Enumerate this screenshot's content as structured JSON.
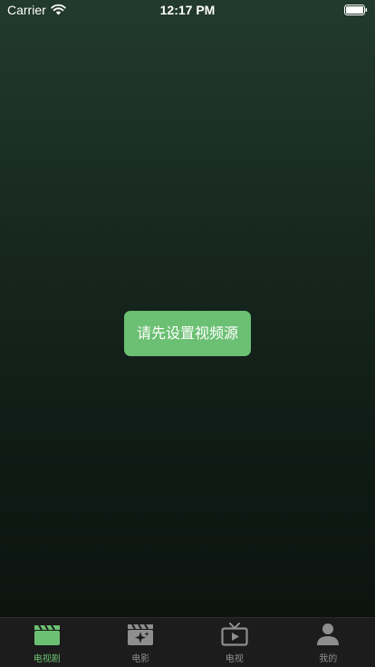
{
  "status_bar": {
    "carrier": "Carrier",
    "time": "12:17 PM"
  },
  "main": {
    "setup_button_label": "请先设置视频源"
  },
  "tab_bar": {
    "active_color": "#6cc073",
    "inactive_color": "#8e8e8e",
    "tabs": [
      {
        "label": "电视剧",
        "icon": "clapperboard-icon",
        "active": true
      },
      {
        "label": "电影",
        "icon": "film-sparkle-icon",
        "active": false
      },
      {
        "label": "电视",
        "icon": "tv-play-icon",
        "active": false
      },
      {
        "label": "我的",
        "icon": "person-icon",
        "active": false
      }
    ]
  }
}
